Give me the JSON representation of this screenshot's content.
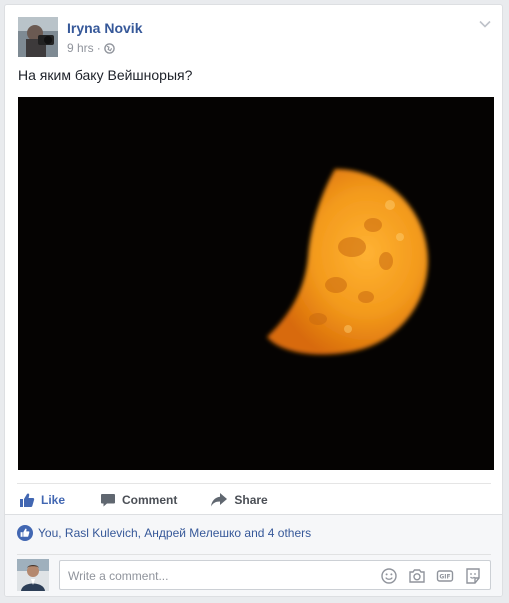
{
  "post": {
    "author": "Iryna Novik",
    "time": "9 hrs",
    "separator": "·",
    "text": "На яким баку Вейшнорыя?"
  },
  "actions": {
    "like": "Like",
    "comment": "Comment",
    "share": "Share"
  },
  "reactions": {
    "summary": "You, Rasl Kulevich, Андрей Мелешко and 4 others"
  },
  "comment_box": {
    "placeholder": "Write a comment..."
  },
  "icons": {
    "privacy": "globe-icon",
    "menu": "chevron-down-icon",
    "like": "thumbs-up-icon",
    "comment": "speech-bubble-icon",
    "share": "share-arrow-icon",
    "emoji": "smiley-icon",
    "photo": "camera-icon",
    "gif": "gif-icon",
    "sticker": "sticker-icon"
  },
  "colors": {
    "link": "#365899",
    "like_blue": "#4267b2",
    "meta_gray": "#90949c",
    "moon_orange": "#f39a1c"
  }
}
